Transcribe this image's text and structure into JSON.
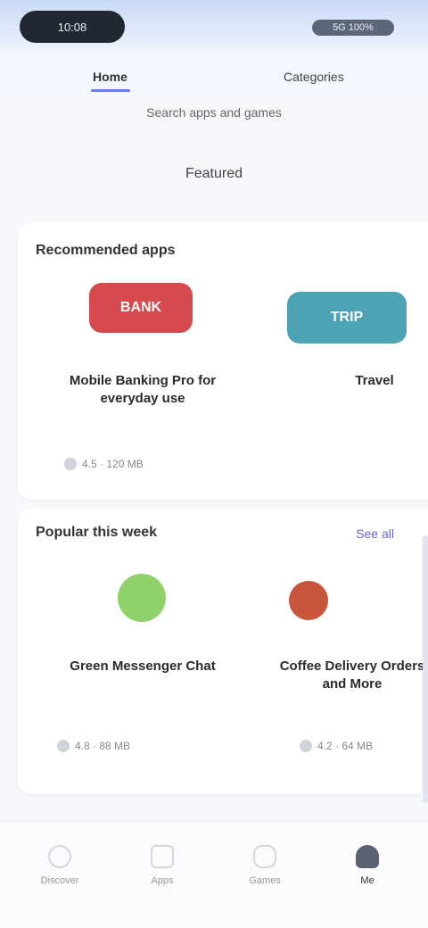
{
  "status_bar": {
    "time": "10:08",
    "indicators": "5G 100%"
  },
  "top_nav": {
    "tabs": [
      {
        "label": "Home",
        "active": true
      },
      {
        "label": "Categories",
        "active": false
      }
    ],
    "accent_color": "#6b7de8"
  },
  "header": {
    "subtitle": "Search apps and games",
    "section_label": "Featured"
  },
  "section_1": {
    "title": "Recommended apps",
    "cards": [
      {
        "name": "Mobile Banking Pro for everyday use",
        "meta": "4.5 · 120 MB",
        "logo_color": "#d64a4f",
        "logo_text": "BANK"
      },
      {
        "name": "Travel",
        "meta": "",
        "logo_color": "#4da2b3",
        "logo_text": "TRIP"
      }
    ]
  },
  "section_2": {
    "title": "Popular this week",
    "link": "See all",
    "cards": [
      {
        "name": "Green Messenger Chat",
        "meta": "4.8 · 88 MB",
        "logo_color": "#8fd16a",
        "logo_text": ""
      },
      {
        "name": "Coffee Delivery Orders and More",
        "meta": "4.2 · 64 MB",
        "logo_color": "#c8553d",
        "logo_text": ""
      }
    ]
  },
  "tab_bar": {
    "tabs": [
      {
        "label": "Discover",
        "icon": "compass-icon"
      },
      {
        "label": "Apps",
        "icon": "grid-icon"
      },
      {
        "label": "Games",
        "icon": "gamepad-icon"
      },
      {
        "label": "Me",
        "icon": "user-icon",
        "active": true
      }
    ]
  }
}
